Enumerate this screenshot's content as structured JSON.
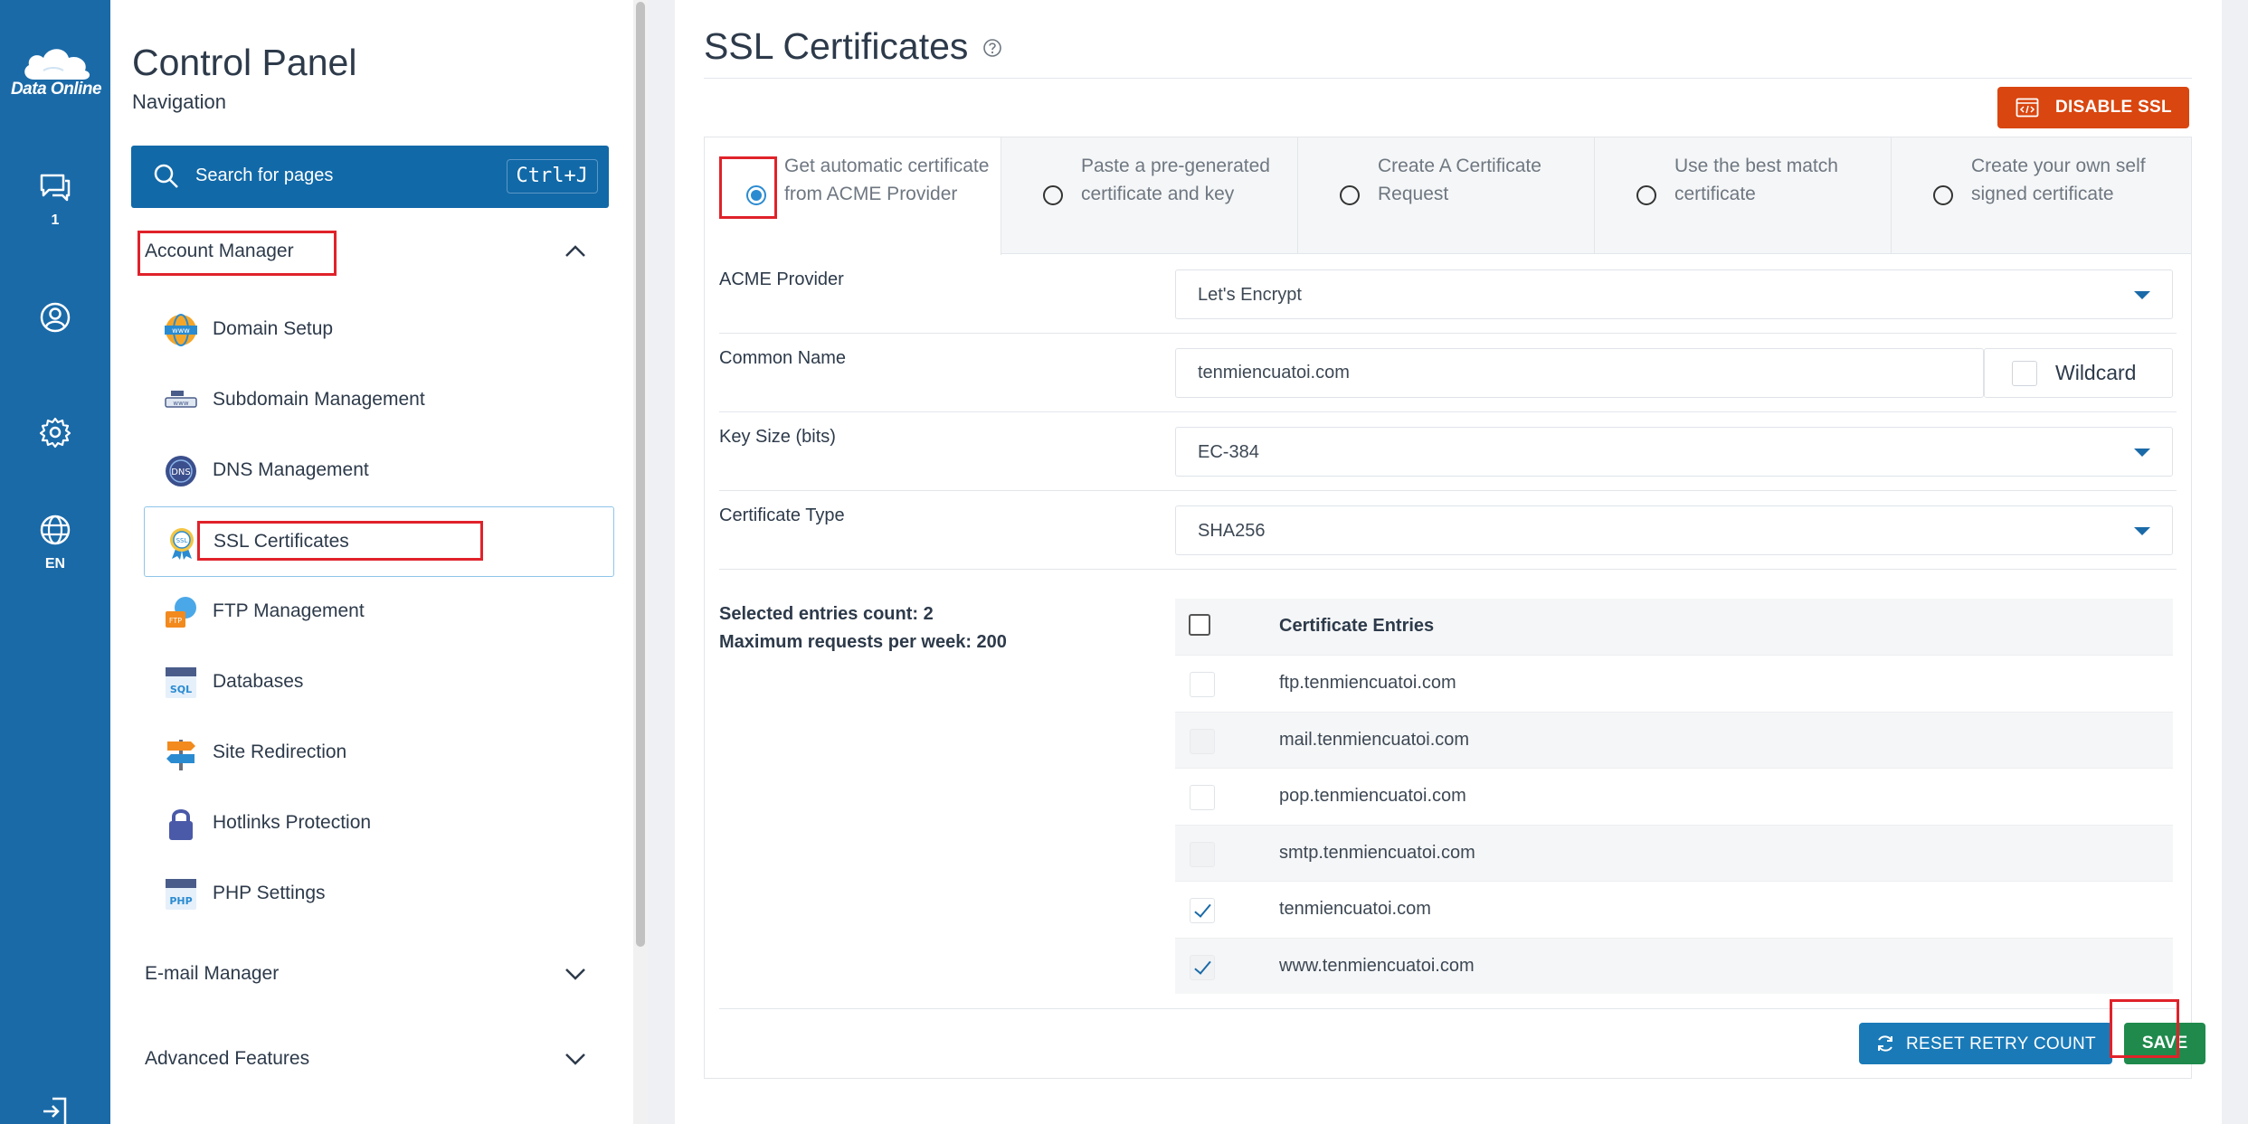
{
  "rail": {
    "logo_text": "Data Online",
    "messages_count": "1",
    "language": "EN"
  },
  "nav": {
    "title": "Control Panel",
    "subtitle": "Navigation",
    "search_placeholder": "Search for pages",
    "search_shortcut": "Ctrl+J",
    "sections": [
      {
        "label": "Account Manager",
        "expanded": true
      },
      {
        "label": "E-mail Manager",
        "expanded": false
      },
      {
        "label": "Advanced Features",
        "expanded": false
      }
    ],
    "items": [
      {
        "label": "Domain Setup",
        "icon": "www-globe-icon"
      },
      {
        "label": "Subdomain Management",
        "icon": "subdomain-icon"
      },
      {
        "label": "DNS Management",
        "icon": "dns-icon"
      },
      {
        "label": "SSL Certificates",
        "icon": "ssl-badge-icon",
        "active": true
      },
      {
        "label": "FTP Management",
        "icon": "ftp-icon"
      },
      {
        "label": "Databases",
        "icon": "sql-database-icon"
      },
      {
        "label": "Site Redirection",
        "icon": "signpost-icon"
      },
      {
        "label": "Hotlinks Protection",
        "icon": "lock-icon"
      },
      {
        "label": "PHP Settings",
        "icon": "php-icon"
      }
    ]
  },
  "main": {
    "title": "SSL Certificates",
    "disable_button": "DISABLE SSL",
    "tabs": [
      {
        "label": "Get automatic certificate from ACME Provider",
        "selected": true
      },
      {
        "label": "Paste a pre-generated certificate and key",
        "selected": false
      },
      {
        "label": "Create A Certificate Request",
        "selected": false
      },
      {
        "label": "Use the best match certificate",
        "selected": false
      },
      {
        "label": "Create your own self signed certificate",
        "selected": false
      }
    ],
    "form": {
      "acme_label": "ACME Provider",
      "acme_value": "Let's Encrypt",
      "common_name_label": "Common Name",
      "common_name_value": "tenmiencuatoi.com",
      "wildcard_label": "Wildcard",
      "key_size_label": "Key Size (bits)",
      "key_size_value": "EC-384",
      "cert_type_label": "Certificate Type",
      "cert_type_value": "SHA256"
    },
    "entries": {
      "selected_count_text": "Selected entries count: 2",
      "max_requests_text": "Maximum requests per week: 200",
      "header": "Certificate Entries",
      "rows": [
        {
          "domain": "ftp.tenmiencuatoi.com",
          "checked": false
        },
        {
          "domain": "mail.tenmiencuatoi.com",
          "checked": false
        },
        {
          "domain": "pop.tenmiencuatoi.com",
          "checked": false
        },
        {
          "domain": "smtp.tenmiencuatoi.com",
          "checked": false
        },
        {
          "domain": "tenmiencuatoi.com",
          "checked": true
        },
        {
          "domain": "www.tenmiencuatoi.com",
          "checked": true
        }
      ]
    },
    "reset_button": "RESET RETRY COUNT",
    "save_button": "SAVE"
  },
  "colors": {
    "rail": "#1a6aa8",
    "search": "#1169a8",
    "disable": "#d9460f",
    "reset": "#1a7ab8",
    "save": "#1f8a4c",
    "highlight": "#e0222a"
  }
}
